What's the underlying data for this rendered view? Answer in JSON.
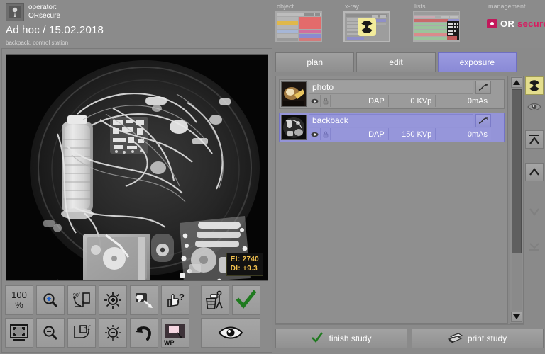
{
  "header": {
    "operator_label": "operator:",
    "operator_name": "ORsecure",
    "operator_icon": "person-badge-icon",
    "study_title": "Ad hoc / 15.02.2018",
    "subtitle": "backpack, control station"
  },
  "modules": [
    {
      "id": "object",
      "label": "object",
      "icon": "table-list-icon"
    },
    {
      "id": "xray",
      "label": "x-ray",
      "icon": "radiation-icon"
    },
    {
      "id": "lists",
      "label": "lists",
      "icon": "worklist-icon"
    },
    {
      "id": "management",
      "label": "management",
      "icon": "orsecure-logo-icon"
    }
  ],
  "brand": {
    "mark": "dot-square-icon",
    "name_first": "OR",
    "name_second": "secure",
    "color_primary": "#d81b60",
    "color_mark": "#c2185b"
  },
  "viewer": {
    "image_alt": "x-ray scan of backpack containing electronics, cylinder, cables and batteries",
    "exposure_indicator_label": "EI:",
    "exposure_indicator_value": "2740",
    "deviation_index_label": "DI:",
    "deviation_index_value": "+9.3",
    "annotation_color": "#f2c14e"
  },
  "toolbar": {
    "row1": [
      {
        "name": "zoom-100-percent-button",
        "icon": "percent-100-icon",
        "label_top": "100",
        "label_bottom": "%"
      },
      {
        "name": "zoom-in-button",
        "icon": "magnifier-plus-icon",
        "label": ""
      },
      {
        "name": "rotate-left-90-button",
        "icon": "rotate-90-ccw-icon",
        "label": ""
      },
      {
        "name": "brightness-up-button",
        "icon": "brightness-plus-icon",
        "label": ""
      },
      {
        "name": "annotate-button",
        "icon": "callout-arrow-icon",
        "label": ""
      },
      {
        "name": "image-quality-button",
        "icon": "thumbs-up-question-icon",
        "label": ""
      },
      {
        "name": "reject-image-button",
        "icon": "trash-person-icon",
        "label": ""
      },
      {
        "name": "accept-image-button",
        "icon": "green-check-icon",
        "label": ""
      }
    ],
    "row2": [
      {
        "name": "fit-to-window-button",
        "icon": "fit-screen-icon",
        "label": ""
      },
      {
        "name": "zoom-out-button",
        "icon": "magnifier-minus-icon",
        "label": ""
      },
      {
        "name": "rotate-right-90-button",
        "icon": "rotate-90-cw-icon",
        "label": ""
      },
      {
        "name": "brightness-down-button",
        "icon": "brightness-minus-icon",
        "label": ""
      },
      {
        "name": "undo-button",
        "icon": "undo-arrow-icon",
        "label": ""
      },
      {
        "name": "white-point-button",
        "icon": "white-point-icon",
        "label": "WP"
      },
      {
        "name": "preview-button",
        "icon": "eye-icon",
        "label": ""
      }
    ]
  },
  "tabs": [
    {
      "id": "plan",
      "label": "plan",
      "active": false
    },
    {
      "id": "edit",
      "label": "edit",
      "active": false
    },
    {
      "id": "exposure",
      "label": "exposure",
      "active": true
    }
  ],
  "expand_button": {
    "name": "expand-panel-button",
    "icon": "expand-diagonal-icon"
  },
  "exposure_list": {
    "columns": [
      "DAP",
      "KVp",
      "mAs"
    ],
    "rows": [
      {
        "name": "photo",
        "thumb": "photo-thumbnail",
        "dap": "DAP",
        "kvp": "0 KVp",
        "mas": "0mAs",
        "selected": false,
        "edit_icon": "edit-curve-icon",
        "eye_icon": "eye-icon",
        "lock_icon": "lock-icon"
      },
      {
        "name": "backback",
        "thumb": "xray-thumbnail",
        "dap": "DAP",
        "kvp": "150 KVp",
        "mas": "0mAs",
        "selected": true,
        "edit_icon": "edit-curve-icon",
        "eye_icon": "eye-icon",
        "lock_icon": "lock-icon"
      }
    ]
  },
  "side_icons": [
    {
      "name": "radiation-status-icon",
      "style": "rad",
      "enabled": true
    },
    {
      "name": "eye-preview-icon",
      "style": "flat",
      "enabled": true
    },
    {
      "name": "collapse-all-icon",
      "style": "framed",
      "enabled": true
    },
    {
      "name": "move-up-icon",
      "style": "framed",
      "enabled": true
    },
    {
      "name": "move-down-icon",
      "style": "flat",
      "enabled": false
    },
    {
      "name": "expand-all-icon",
      "style": "flat",
      "enabled": false
    }
  ],
  "scrollbar": {
    "name": "exposure-list-scrollbar",
    "up_icon": "triangle-up-icon",
    "down_icon": "triangle-down-icon"
  },
  "footer": {
    "finish_study_label": "finish study",
    "finish_study_icon": "green-check-icon",
    "print_study_label": "print study",
    "print_study_icon": "printer-icon"
  },
  "colors": {
    "background": "#8a8a8a",
    "panel": "#8f8f8f",
    "accent_selected": "#9494d8",
    "tab_active": "#8a8ad6",
    "text": "#ffffff",
    "radiation_yellow": "#e3dd8d"
  }
}
